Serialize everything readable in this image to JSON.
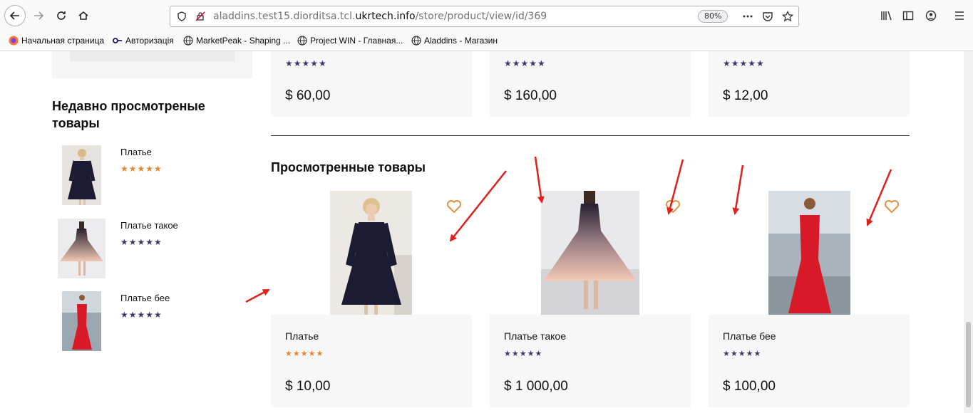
{
  "browser": {
    "url_host_prefix": "aladdins.test15.diorditsa.tcl.",
    "url_host_domain": "ukrtech.info",
    "url_path": "/store/product/view/id/369",
    "zoom": "80%",
    "bookmarks": [
      {
        "label": "Начальная страница",
        "icon": "firefox-icon"
      },
      {
        "label": "Авторизація",
        "icon": "key-icon"
      },
      {
        "label": "MarketPeak - Shaping ...",
        "icon": "globe-icon"
      },
      {
        "label": "Project WIN - Главная...",
        "icon": "globe-icon"
      },
      {
        "label": "Aladdins - Магазин",
        "icon": "globe-icon"
      }
    ]
  },
  "recent": {
    "title": "Недавно просмотреные товары",
    "items": [
      {
        "name": "Платье",
        "rating": "4.5",
        "stars_style": "orange"
      },
      {
        "name": "Платье такое",
        "rating": "0",
        "stars_style": "empty"
      },
      {
        "name": "Платье бее",
        "rating": "0",
        "stars_style": "empty"
      }
    ]
  },
  "top_products": [
    {
      "price": "$ 60,00"
    },
    {
      "price": "$ 160,00"
    },
    {
      "price": "$ 12,00"
    }
  ],
  "viewed": {
    "title": "Просмотренные товары",
    "items": [
      {
        "name": "Платье",
        "price": "$ 10,00",
        "stars_style": "orange"
      },
      {
        "name": "Платье такое",
        "price": "$ 1 000,00",
        "stars_style": "empty"
      },
      {
        "name": "Платье бее",
        "price": "$ 100,00",
        "stars_style": "empty"
      }
    ]
  },
  "colors": {
    "accent_orange": "#e8852f",
    "star_dark": "#3d3a6b",
    "annotation_red": "#e0201b"
  }
}
